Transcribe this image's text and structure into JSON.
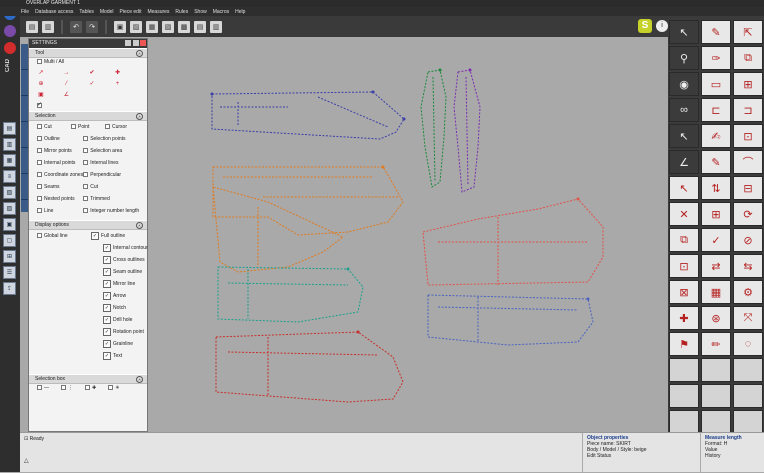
{
  "app": {
    "title": "GERBER ACCUMARK 11.0",
    "window_label": "OVERLAP GARMENT 1"
  },
  "menu": [
    "File",
    "Database access",
    "Tables",
    "Model",
    "Piece edit",
    "Measures",
    "Rules",
    "Show",
    "Macros",
    "Help"
  ],
  "left_app_labels": {
    "cad": "CAD"
  },
  "panel": {
    "title": "SETTINGS",
    "sections": {
      "tool": {
        "label": "Tool",
        "multi": "Multi / All"
      },
      "selection": {
        "label": "Selection",
        "items": [
          "Cut",
          "Point",
          "Cursor",
          "Outline",
          "Selection points",
          "Mirror points",
          "Selection area",
          "Internal points",
          "Internal lines",
          "Coordinate zones",
          "Perpendicular",
          "Seams",
          "Cut",
          "Nested points",
          "Trimmed",
          "Line",
          "Integer number length"
        ]
      },
      "display": {
        "label": "Display options",
        "left_item": "Global line",
        "tree": [
          "Full outline",
          "Internal contour",
          "Cross outlines",
          "Seam outline",
          "Mirror line",
          "Arrow",
          "Notch",
          "Drill hole",
          "Rotation point",
          "Grainline",
          "Text"
        ]
      },
      "selection_box": {
        "label": "Selection box"
      }
    }
  },
  "status": {
    "left_text": "Ready",
    "col2_header": "Object properties",
    "col2_lines": [
      "Piece name: SKIRT",
      "Body / Model / Style: beige",
      "Edit Status"
    ],
    "col3_header": "Measure length",
    "col3_lines": [
      "Format: H",
      "Value",
      "History"
    ]
  },
  "colors": {
    "navy": "#3b3fa8",
    "green": "#1b8a3c",
    "purple": "#7a2fb0",
    "orange": "#e07a1e",
    "teal": "#1aa08c",
    "red": "#c7302b",
    "coral": "#e0524a",
    "blue": "#4a62c0"
  },
  "right_tools": [
    "select-icon",
    "align-icon",
    "mirror-icon",
    "zoom-icon",
    "pen-brush-icon",
    "piece-copy-icon",
    "view-eye-icon",
    "piece-new-icon",
    "piece-add-icon",
    "glasses-icon",
    "seam-icon",
    "fold-icon",
    "pointer-icon",
    "doc-edit-icon",
    "shape-icon",
    "measure-angle-icon",
    "piece-edit-icon",
    "notch-icon",
    "pointer-move-icon",
    "split-icon",
    "mirror-split-icon",
    "doc-x-icon",
    "grid-mark-icon",
    "rotate-icon",
    "doc-dup-icon",
    "doc-check-icon",
    "doc-split-icon",
    "doc-lock-icon",
    "doc-arrow-icon",
    "swap-icon",
    "doc-lock2-icon",
    "doc-grid-icon",
    "gear-icon",
    "doc-plus-icon",
    "doc-pin-icon",
    "transform-icon",
    "doc-flag-icon",
    "doc-pencil-icon",
    "trace-icon"
  ]
}
